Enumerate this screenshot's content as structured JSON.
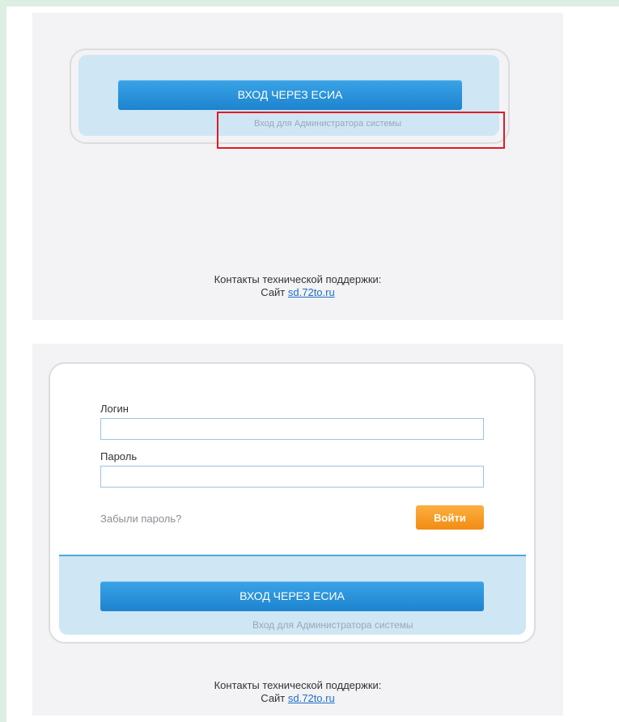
{
  "top_panel": {
    "esia_button_label": "ВХОД ЧЕРЕЗ ЕСИА",
    "admin_link_label": "Вход для Администратора системы",
    "contacts_label": "Контакты технической поддержки:",
    "site_prefix": "Сайт",
    "site_link": "sd.72to.ru"
  },
  "bottom_panel": {
    "login_label": "Логин",
    "login_value": "",
    "password_label": "Пароль",
    "password_value": "",
    "forgot_password_label": "Забыли пароль?",
    "submit_label": "Войти",
    "esia_button_label": "ВХОД ЧЕРЕЗ ЕСИА",
    "admin_link_label": "Вход для Администратора системы",
    "contacts_label": "Контакты технической поддержки:",
    "site_prefix": "Сайт",
    "site_link": "sd.72to.ru"
  },
  "colors": {
    "esia_button": "#1d83cf",
    "login_button": "#f28c12",
    "highlight_border": "#e01b24",
    "link": "#1f6fc7"
  }
}
